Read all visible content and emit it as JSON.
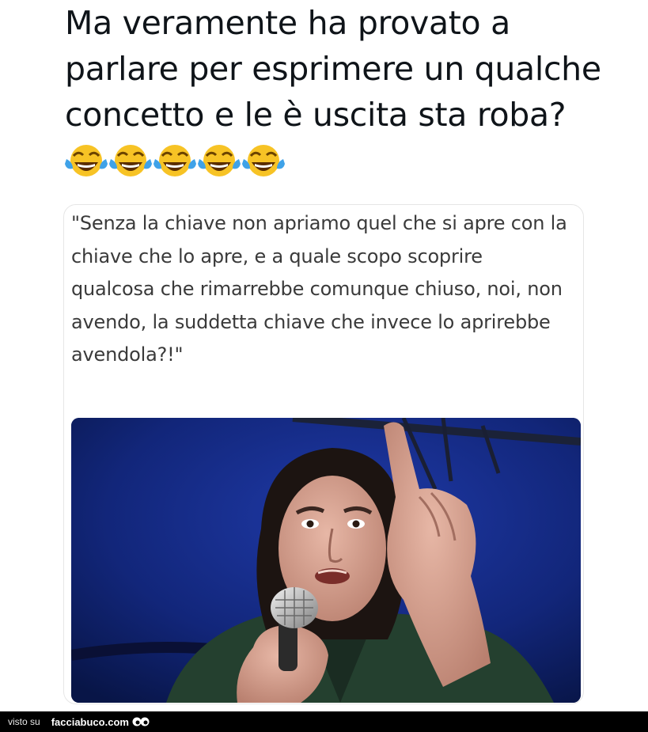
{
  "post": {
    "headline": "Ma veramente ha provato a parlare per esprimere un qualche concetto e le è uscita sta roba?",
    "emoji_icon": "face-with-tears-of-joy-icon",
    "emoji_count": 5
  },
  "quoted": {
    "text": "\"Senza la chiave non apriamo quel che si apre con la chiave che lo apre, e a quale scopo scoprire qualcosa che rimarrebbe comunque chiuso, noi, non avendo, la suddetta chiave che invece lo aprirebbe avendola?!\""
  },
  "footer": {
    "visto_su": "visto su",
    "brand": "facciabuco.com",
    "eyes_icon": "googly-eyes-icon"
  },
  "colors": {
    "text": "#0f1419",
    "quote_text": "#3a3a3a",
    "photo_background": "#0d1c63",
    "footer_background": "#000000"
  }
}
